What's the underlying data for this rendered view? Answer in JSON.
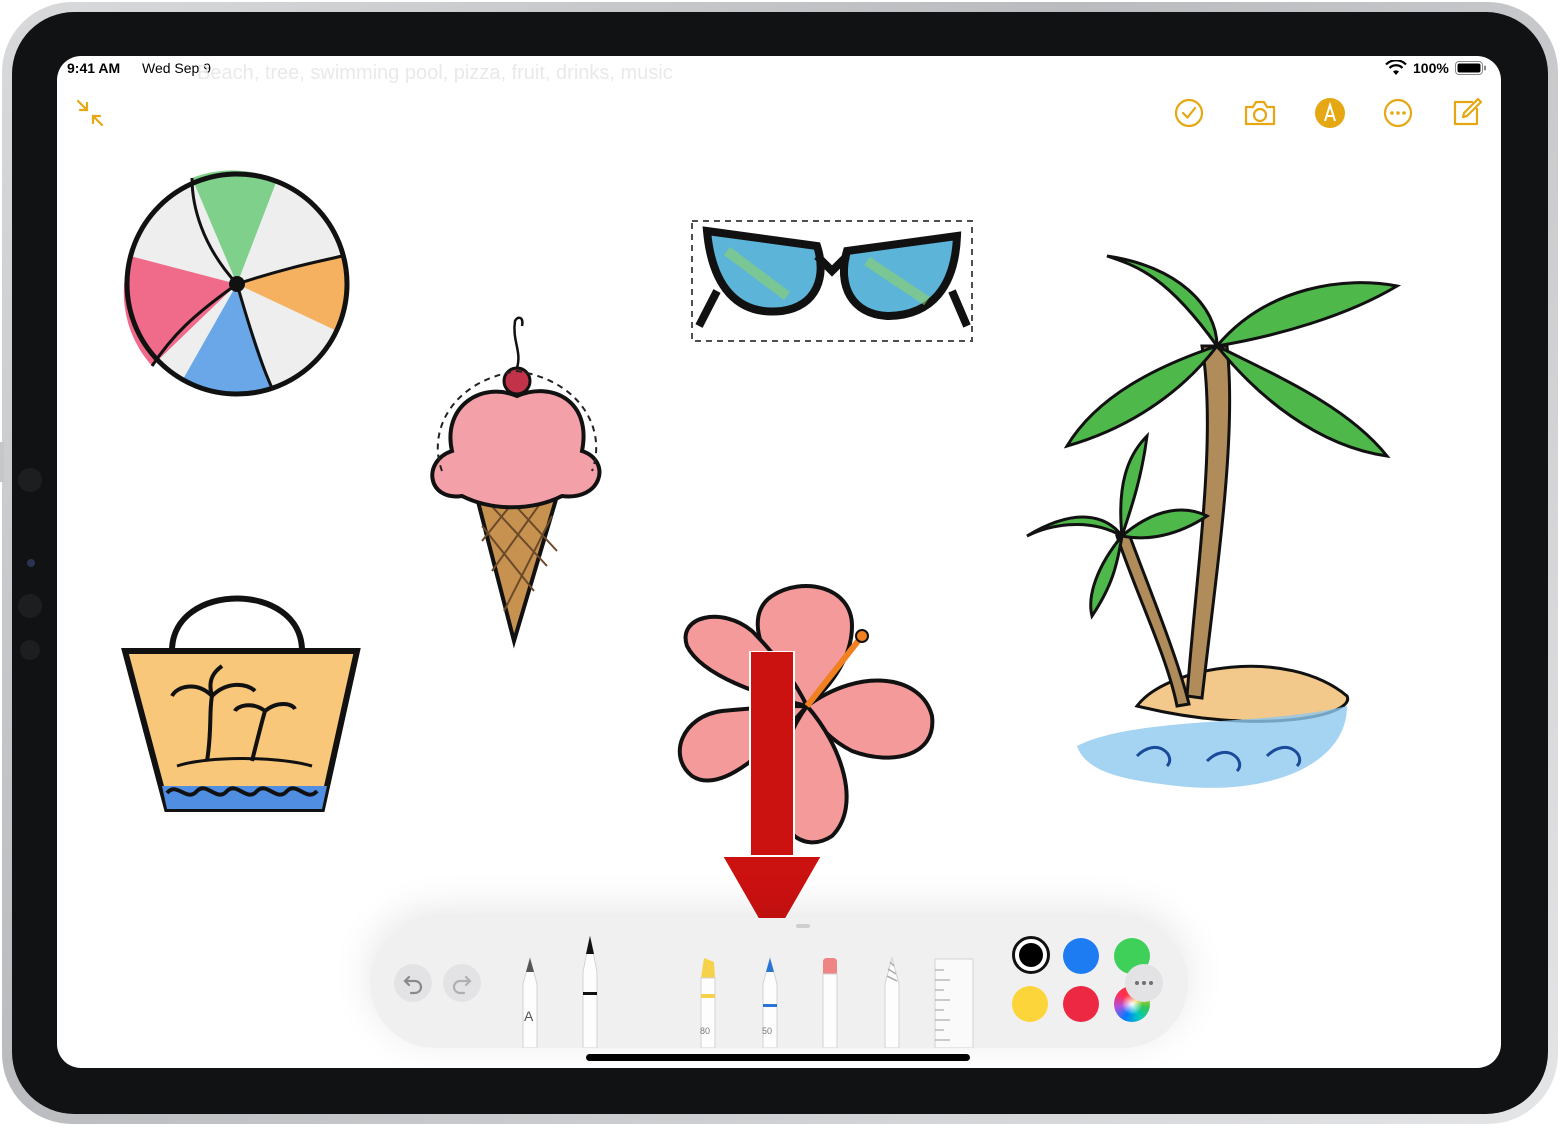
{
  "status_bar": {
    "time": "9:41 AM",
    "date": "Wed Sep 9",
    "battery": "100%"
  },
  "note": {
    "ghost_text": "Beach, tree, swimming pool, pizza, fruit, drinks, music"
  },
  "toolbar": {
    "collapse_icon": "collapse-arrows-icon",
    "checklist_icon": "checkmark-circle-icon",
    "camera_icon": "camera-icon",
    "markup_icon": "pencil-tip-circle-icon",
    "more_icon": "ellipsis-circle-icon",
    "compose_icon": "compose-icon",
    "accent": "#e5a812"
  },
  "palette": {
    "tools": [
      {
        "name": "monoline-pen",
        "label": "A"
      },
      {
        "name": "pen",
        "label": ""
      },
      {
        "name": "highlighter",
        "label": "80"
      },
      {
        "name": "pencil",
        "label": "50"
      },
      {
        "name": "eraser",
        "label": ""
      },
      {
        "name": "lasso",
        "label": ""
      },
      {
        "name": "ruler",
        "label": ""
      }
    ],
    "colors": [
      "#000000",
      "#1e7cf3",
      "#3fd05a",
      "#fbd53a",
      "#ed2843",
      "multicolor"
    ]
  },
  "annotation": {
    "arrow_color": "#cc1111",
    "points_to": "eraser"
  }
}
